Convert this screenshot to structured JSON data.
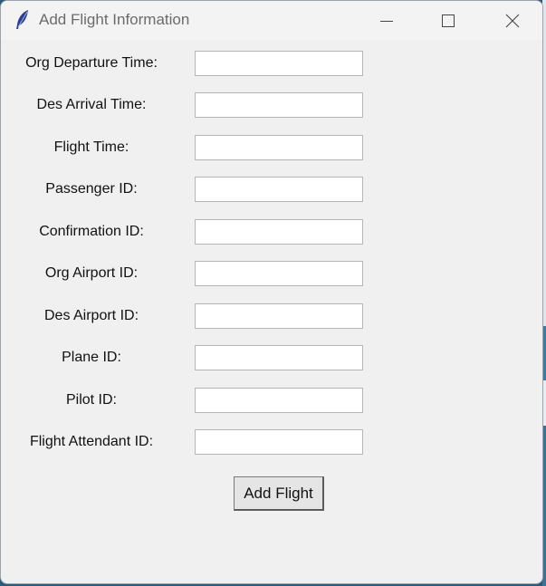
{
  "window": {
    "title": "Add Flight Information",
    "app_icon": "feather-icon",
    "controls": {
      "minimize_icon": "minimize-icon",
      "maximize_icon": "maximize-icon",
      "close_icon": "close-icon"
    }
  },
  "form": {
    "fields": [
      {
        "label": "Org Departure Time:",
        "value": ""
      },
      {
        "label": "Des Arrival Time:",
        "value": ""
      },
      {
        "label": "Flight Time:",
        "value": ""
      },
      {
        "label": "Passenger ID:",
        "value": ""
      },
      {
        "label": "Confirmation ID:",
        "value": ""
      },
      {
        "label": "Org Airport ID:",
        "value": ""
      },
      {
        "label": "Des Airport ID:",
        "value": ""
      },
      {
        "label": "Plane ID:",
        "value": ""
      },
      {
        "label": "Pilot ID:",
        "value": ""
      },
      {
        "label": "Flight Attendant ID:",
        "value": ""
      }
    ],
    "submit_label": "Add Flight"
  },
  "colors": {
    "window_bg": "#f0f0f0",
    "titlebar_bg": "#f3f3f3",
    "title_text": "#6b6b6b",
    "input_bg": "#ffffff",
    "button_bg": "#e5e5e5"
  }
}
